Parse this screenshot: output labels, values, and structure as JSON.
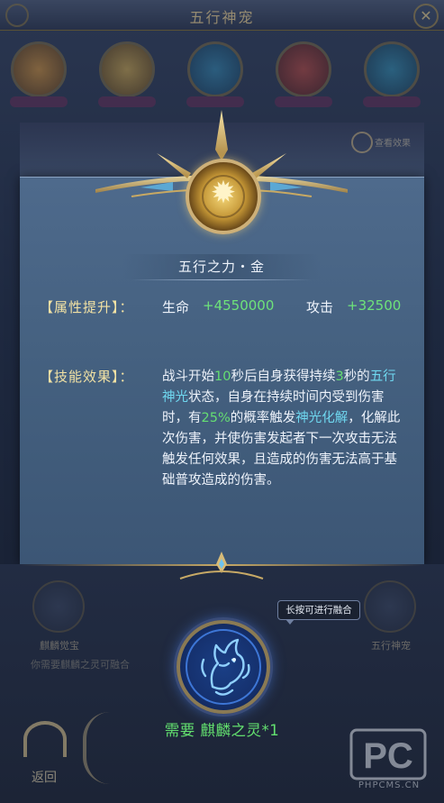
{
  "background": {
    "title": "五行神宠",
    "avatar_count": 5,
    "side_left_label": "麒麟觉宝",
    "side_right_label": "五行神宠",
    "tip_text": "你需要麒麟之灵可融合",
    "top_corner_label": "查看效果",
    "bottom_button_label": "返回"
  },
  "modal": {
    "skill_title": "五行之力・金",
    "attributes": {
      "label": "【属性提升】：",
      "hp_name": "生命",
      "hp_value": "+4550000",
      "atk_name": "攻击",
      "atk_value": "+32500"
    },
    "skill_effect": {
      "label": "【技能效果】：",
      "segments": [
        {
          "text": "战斗开始",
          "style": "normal"
        },
        {
          "text": "10",
          "style": "green"
        },
        {
          "text": "秒后自身获得持续",
          "style": "normal"
        },
        {
          "text": "3",
          "style": "green"
        },
        {
          "text": "秒的",
          "style": "normal"
        },
        {
          "text": "五行神光",
          "style": "cyan"
        },
        {
          "text": "状态，自身在持续时间内受到伤害时，有",
          "style": "normal"
        },
        {
          "text": "25%",
          "style": "green"
        },
        {
          "text": "的概率触发",
          "style": "normal"
        },
        {
          "text": "神光化解",
          "style": "cyan"
        },
        {
          "text": "，化解此次伤害，并使伤害发起者下一次攻击无法触发任何效果，且造成的伤害无法高于基础普攻造成的伤害。",
          "style": "normal"
        }
      ]
    }
  },
  "fusion": {
    "tooltip": "长按可进行融合",
    "requirement": "需要 麒麟之灵*1",
    "icon": "qilin-icon"
  },
  "watermark": {
    "logo_text": "PC",
    "site": "PHPCMS.CN"
  },
  "colors": {
    "accent_gold": "#cdb078",
    "highlight_green": "#65de72",
    "highlight_cyan": "#6fd8f0",
    "label_yellow": "#f2e2a4"
  }
}
